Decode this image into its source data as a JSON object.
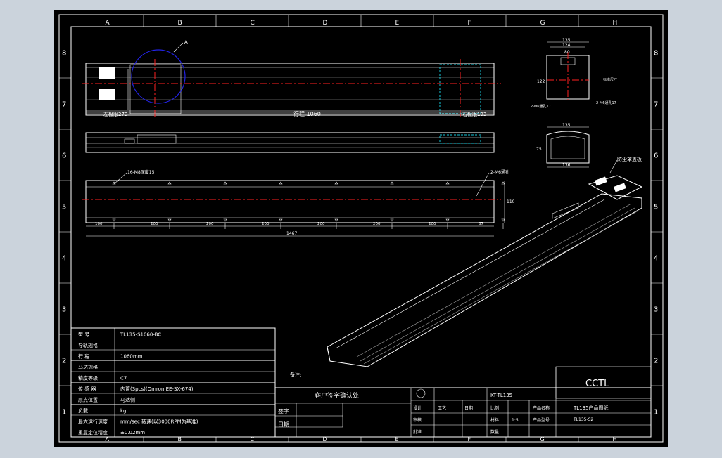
{
  "grid": {
    "cols": [
      "A",
      "B",
      "C",
      "D",
      "E",
      "F",
      "G",
      "H"
    ],
    "rows": [
      "8",
      "7",
      "6",
      "5",
      "4",
      "3",
      "2",
      "1"
    ]
  },
  "view_labels": {
    "detail_a": "A",
    "left_travel": "左极限279",
    "stroke": "行程 1060",
    "right_travel": "右极限133",
    "hole_left": "16-M8深度15",
    "hole_right": "2-M6通孔",
    "dims_bottom": [
      "100",
      "200",
      "200",
      "200",
      "200",
      "200",
      "200",
      "67"
    ],
    "overall_length": "1467",
    "height_dim": "110",
    "sec_top_w1": "135",
    "sec_top_w2": "124",
    "sec_top_w3": "80",
    "sec_top_h": "122",
    "sec_note_left": "2-M6通孔17",
    "sec_note_right": "2-M6通孔17",
    "sec_note_side": "标准尺寸",
    "sec_bot_w": "135",
    "sec_bot_w2": "136",
    "sec_bot_h": "75",
    "iso_label": "防尘罩盖板"
  },
  "spec_table": {
    "rows": [
      {
        "label": "型  号",
        "value": "TL135-S1060-BC"
      },
      {
        "label": "导轨规格",
        "value": ""
      },
      {
        "label": "行  程",
        "value": "1060mm"
      },
      {
        "label": "马达规格",
        "value": ""
      },
      {
        "label": "精度等级",
        "value": "C7"
      },
      {
        "label": "传 感 器",
        "value": "内置(3pcs)(Omron EE-SX-674)"
      },
      {
        "label": "原点位置",
        "value": "马达侧"
      },
      {
        "label": "负载",
        "value": "kg"
      },
      {
        "label": "最大运行速度",
        "value": "mm/sec  转速(以3000RPM为基准)"
      },
      {
        "label": "重复定位精度",
        "value": "±0.02mm"
      }
    ],
    "note": "备注:"
  },
  "title_block": {
    "customer_confirm": "客户签字确认处",
    "sign_label": "签字",
    "date_label": "日期",
    "design_code": "KT-TL135",
    "product_name": "TL135产品图纸",
    "part_no": "TL135-S2",
    "company": "CCTL",
    "cells": [
      "设计",
      "审核",
      "批准",
      "工艺",
      "日期",
      "比例",
      "材料",
      "1:5",
      "数量",
      "产品名称",
      "产品型号"
    ]
  }
}
